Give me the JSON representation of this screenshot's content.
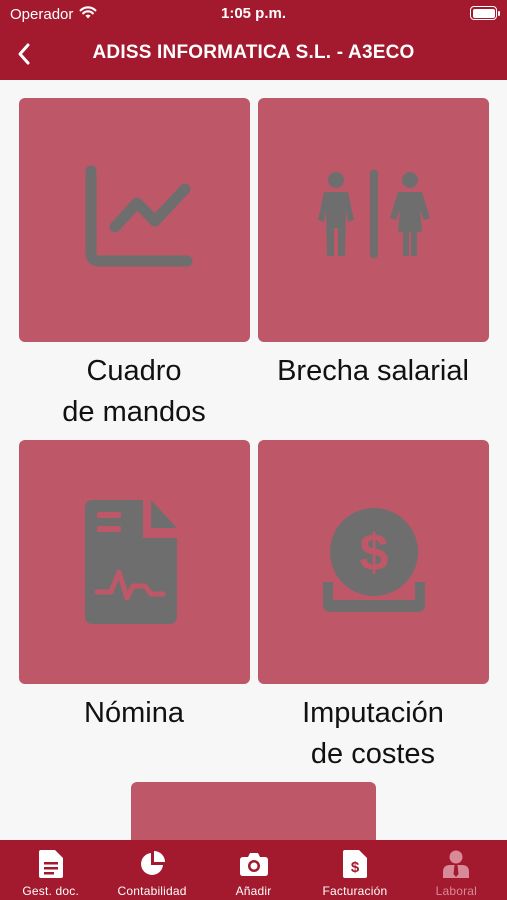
{
  "status": {
    "carrier": "Operador",
    "time": "1:05 p.m."
  },
  "nav": {
    "title": "ADISS INFORMATICA S.L. - A3ECO"
  },
  "tiles": [
    {
      "label_line1": "Cuadro",
      "label_line2": "de mandos",
      "icon": "line-chart-icon"
    },
    {
      "label_line1": "Brecha salarial",
      "label_line2": "",
      "icon": "gender-icon"
    },
    {
      "label_line1": "Nómina",
      "label_line2": "",
      "icon": "payslip-document-icon"
    },
    {
      "label_line1": "Imputación",
      "label_line2": "de costes",
      "icon": "dollar-coin-icon"
    }
  ],
  "tabs": [
    {
      "label": "Gest. doc.",
      "icon": "document-icon",
      "active": true
    },
    {
      "label": "Contabilidad",
      "icon": "pie-chart-icon",
      "active": true
    },
    {
      "label": "Añadir",
      "icon": "camera-icon",
      "active": true
    },
    {
      "label": "Facturación",
      "icon": "invoice-icon",
      "active": true
    },
    {
      "label": "Laboral",
      "icon": "person-tie-icon",
      "active": false
    }
  ],
  "colors": {
    "brand": "#a3192d",
    "tile": "#be5868",
    "icon": "#6e6e6e",
    "background": "#f7f7f7"
  }
}
